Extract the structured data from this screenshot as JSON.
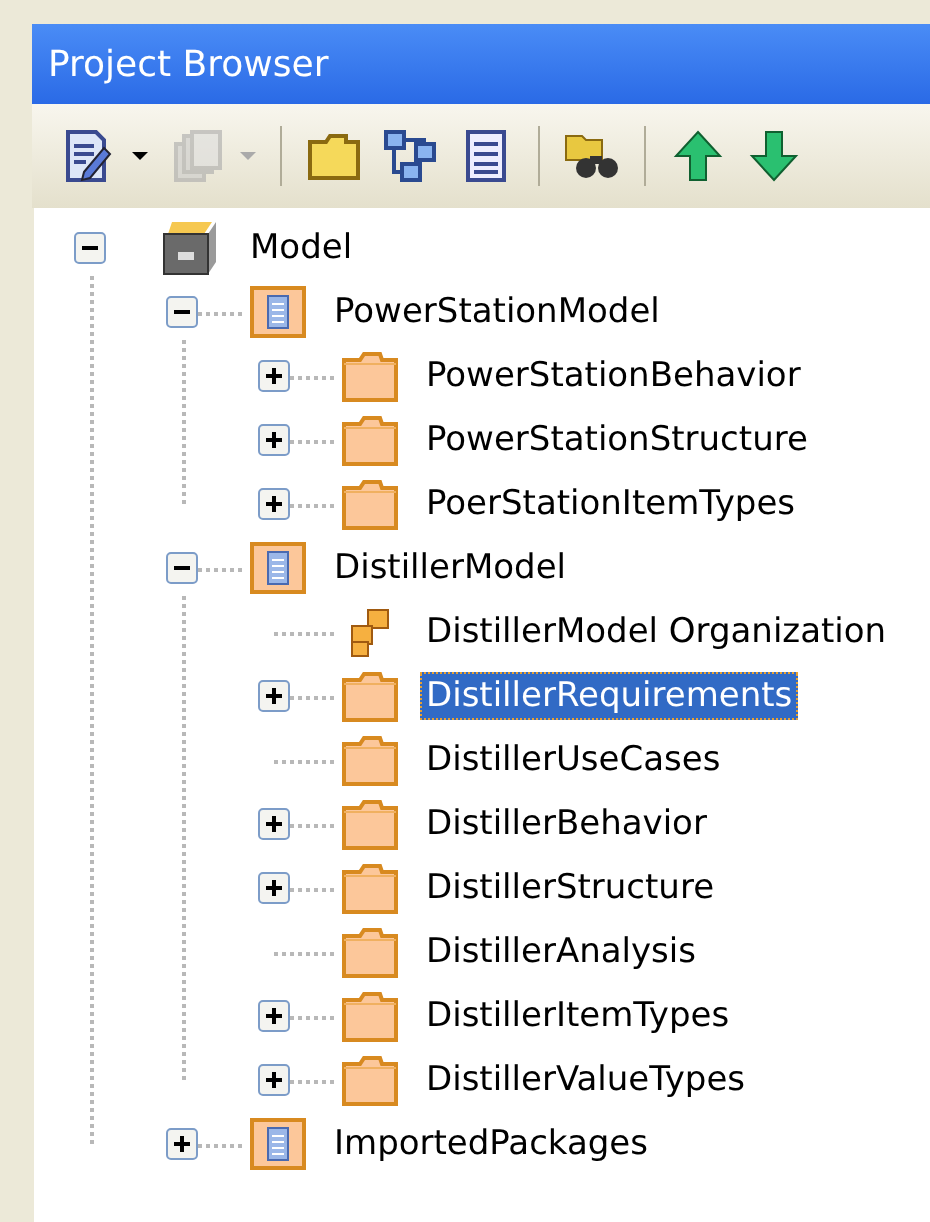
{
  "window": {
    "title": "Project Browser"
  },
  "toolbar": [
    {
      "kind": "edit",
      "disabled": false,
      "dropdown": true
    },
    {
      "kind": "copy",
      "disabled": true,
      "dropdown": true
    },
    {
      "kind": "separator"
    },
    {
      "kind": "folder",
      "disabled": false
    },
    {
      "kind": "diagram",
      "disabled": false
    },
    {
      "kind": "list",
      "disabled": false
    },
    {
      "kind": "separator"
    },
    {
      "kind": "find",
      "disabled": false
    },
    {
      "kind": "separator"
    },
    {
      "kind": "up",
      "disabled": false
    },
    {
      "kind": "down",
      "disabled": false
    }
  ],
  "tree": [
    {
      "label": "Model",
      "kind": "model",
      "expanded": true,
      "selected": false,
      "children": [
        {
          "label": "PowerStationModel",
          "kind": "package",
          "expanded": true,
          "selected": false,
          "children": [
            {
              "label": "PowerStationBehavior",
              "kind": "folder",
              "expanded": false,
              "selected": false
            },
            {
              "label": "PowerStationStructure",
              "kind": "folder",
              "expanded": false,
              "selected": false
            },
            {
              "label": "PoerStationItemTypes",
              "kind": "folder",
              "expanded": false,
              "selected": false
            }
          ]
        },
        {
          "label": "DistillerModel",
          "kind": "package",
          "expanded": true,
          "selected": false,
          "children": [
            {
              "label": "DistillerModel Organization",
              "kind": "organization",
              "selected": false
            },
            {
              "label": "DistillerRequirements",
              "kind": "folder",
              "expanded": false,
              "selected": true
            },
            {
              "label": "DistillerUseCases",
              "kind": "folder",
              "selected": false
            },
            {
              "label": "DistillerBehavior",
              "kind": "folder",
              "expanded": false,
              "selected": false
            },
            {
              "label": "DistillerStructure",
              "kind": "folder",
              "expanded": false,
              "selected": false
            },
            {
              "label": "DistillerAnalysis",
              "kind": "folder",
              "selected": false
            },
            {
              "label": "DistillerItemTypes",
              "kind": "folder",
              "expanded": false,
              "selected": false
            },
            {
              "label": "DistillerValueTypes",
              "kind": "folder",
              "expanded": false,
              "selected": false
            }
          ]
        },
        {
          "label": "ImportedPackages",
          "kind": "package",
          "expanded": false,
          "selected": false
        }
      ]
    }
  ]
}
